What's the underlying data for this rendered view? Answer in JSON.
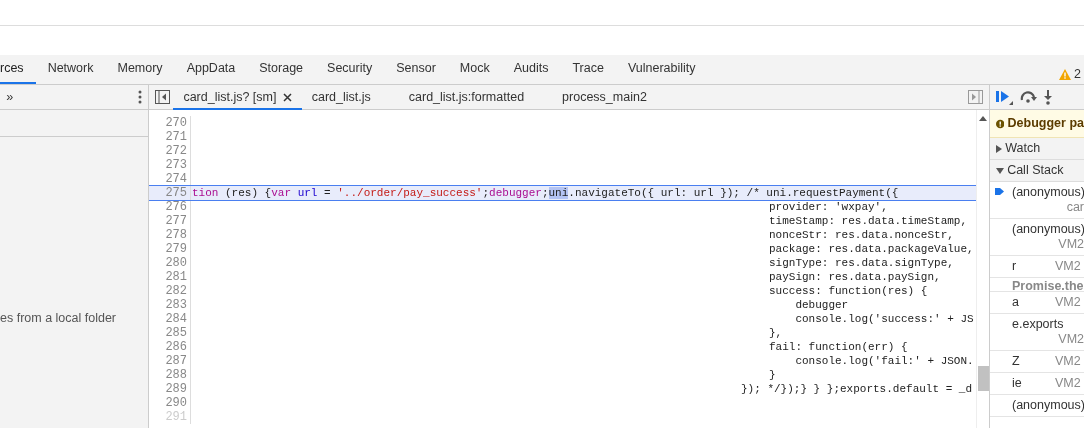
{
  "panel_tabs": [
    {
      "label": "rces",
      "selected": true
    },
    {
      "label": "Network",
      "selected": false
    },
    {
      "label": "Memory",
      "selected": false
    },
    {
      "label": "AppData",
      "selected": false
    },
    {
      "label": "Storage",
      "selected": false
    },
    {
      "label": "Security",
      "selected": false
    },
    {
      "label": "Sensor",
      "selected": false
    },
    {
      "label": "Mock",
      "selected": false
    },
    {
      "label": "Audits",
      "selected": false
    },
    {
      "label": "Trace",
      "selected": false
    },
    {
      "label": "Vulnerability",
      "selected": false
    }
  ],
  "warnings": {
    "count": "2"
  },
  "navigator": {
    "more": "»",
    "hint": "es from a local folder"
  },
  "file_tabs": [
    {
      "label": "card_list.js? [sm]",
      "selected": true,
      "closable": true
    },
    {
      "label": "card_list.js",
      "selected": false,
      "closable": false
    },
    {
      "label": "card_list.js:formatted",
      "selected": false,
      "closable": false
    },
    {
      "label": "process_main2",
      "selected": false,
      "closable": false
    }
  ],
  "code_lines": [
    {
      "number": "270",
      "highlighted": false,
      "dimmed": false
    },
    {
      "number": "271",
      "highlighted": false,
      "dimmed": false
    },
    {
      "number": "272",
      "highlighted": false,
      "dimmed": false
    },
    {
      "number": "273",
      "highlighted": false,
      "dimmed": false
    },
    {
      "number": "274",
      "highlighted": false,
      "dimmed": false
    },
    {
      "number": "275",
      "highlighted": true,
      "dimmed": false,
      "tokens": [
        {
          "kind": "keyword",
          "text": "tion"
        },
        {
          "kind": "plain",
          "text": " (res) {"
        },
        {
          "kind": "keyword",
          "text": "var"
        },
        {
          "kind": "variable",
          "text": " url"
        },
        {
          "kind": "plain",
          "text": " = "
        },
        {
          "kind": "string",
          "text": "'../order/pay_success'"
        },
        {
          "kind": "plain",
          "text": ";"
        },
        {
          "kind": "keyword",
          "text": "debugger"
        },
        {
          "kind": "plain",
          "text": ";"
        },
        {
          "kind": "selection",
          "text": "uni"
        },
        {
          "kind": "plain",
          "text": ".navigateTo({ url: url }); /* uni.requestPayment({"
        }
      ]
    },
    {
      "number": "276",
      "highlighted": false,
      "dimmed": false,
      "tokens": [
        {
          "kind": "plain",
          "text": "provider: 'wxpay',"
        }
      ]
    },
    {
      "number": "277",
      "highlighted": false,
      "dimmed": false,
      "tokens": [
        {
          "kind": "plain",
          "text": "timeStamp: res.data.timeStamp,"
        }
      ]
    },
    {
      "number": "278",
      "highlighted": false,
      "dimmed": false,
      "tokens": [
        {
          "kind": "plain",
          "text": "nonceStr: res.data.nonceStr,"
        }
      ]
    },
    {
      "number": "279",
      "highlighted": false,
      "dimmed": false,
      "tokens": [
        {
          "kind": "plain",
          "text": "package: res.data.packageValue,"
        }
      ]
    },
    {
      "number": "280",
      "highlighted": false,
      "dimmed": false,
      "tokens": [
        {
          "kind": "plain",
          "text": "signType: res.data.signType,"
        }
      ]
    },
    {
      "number": "281",
      "highlighted": false,
      "dimmed": false,
      "tokens": [
        {
          "kind": "plain",
          "text": "paySign: res.data.paySign,"
        }
      ]
    },
    {
      "number": "282",
      "highlighted": false,
      "dimmed": false,
      "tokens": [
        {
          "kind": "plain",
          "text": "success: function(res) {"
        }
      ]
    },
    {
      "number": "283",
      "highlighted": false,
      "dimmed": false,
      "tokens": [
        {
          "kind": "plain",
          "text": "    debugger"
        }
      ]
    },
    {
      "number": "284",
      "highlighted": false,
      "dimmed": false,
      "tokens": [
        {
          "kind": "plain",
          "text": "    console.log('success:' + JS"
        }
      ]
    },
    {
      "number": "285",
      "highlighted": false,
      "dimmed": false,
      "tokens": [
        {
          "kind": "plain",
          "text": "},"
        }
      ]
    },
    {
      "number": "286",
      "highlighted": false,
      "dimmed": false,
      "tokens": [
        {
          "kind": "plain",
          "text": "fail: function(err) {"
        }
      ]
    },
    {
      "number": "287",
      "highlighted": false,
      "dimmed": false,
      "tokens": [
        {
          "kind": "plain",
          "text": "    console.log('fail:' + JSON."
        }
      ]
    },
    {
      "number": "288",
      "highlighted": false,
      "dimmed": false,
      "tokens": [
        {
          "kind": "plain",
          "text": "}"
        }
      ]
    },
    {
      "number": "289",
      "highlighted": false,
      "dimmed": false,
      "tokens": [
        {
          "kind": "plain",
          "text": "}); */});} } };exports.default = _d"
        }
      ]
    },
    {
      "number": "290",
      "highlighted": false,
      "dimmed": false
    },
    {
      "number": "291",
      "highlighted": false,
      "dimmed": true
    }
  ],
  "debugger": {
    "banner": "Debugger pa",
    "sections": [
      {
        "label": "Watch",
        "expanded": false
      },
      {
        "label": "Call Stack",
        "expanded": true
      }
    ],
    "call_stack": [
      {
        "kind": "frame",
        "name": "(anonymous)",
        "location": "car",
        "current": true,
        "location_below": true
      },
      {
        "kind": "frame",
        "name": "(anonymous)",
        "location": "VM2",
        "current": false,
        "location_below": true
      },
      {
        "kind": "frame",
        "name": "r",
        "location": "VM2",
        "current": false,
        "location_below": false
      },
      {
        "kind": "async",
        "name": "Promise.the"
      },
      {
        "kind": "frame",
        "name": "a",
        "location": "VM2",
        "current": false,
        "location_below": false
      },
      {
        "kind": "frame",
        "name": "e.exports",
        "location": "VM2",
        "current": false,
        "location_below": true
      },
      {
        "kind": "frame",
        "name": "Z",
        "location": "VM2",
        "current": false,
        "location_below": false
      },
      {
        "kind": "frame",
        "name": "ie",
        "location": "VM2",
        "current": false,
        "location_below": false
      },
      {
        "kind": "frame",
        "name": "(anonymous)",
        "current": false
      }
    ]
  }
}
